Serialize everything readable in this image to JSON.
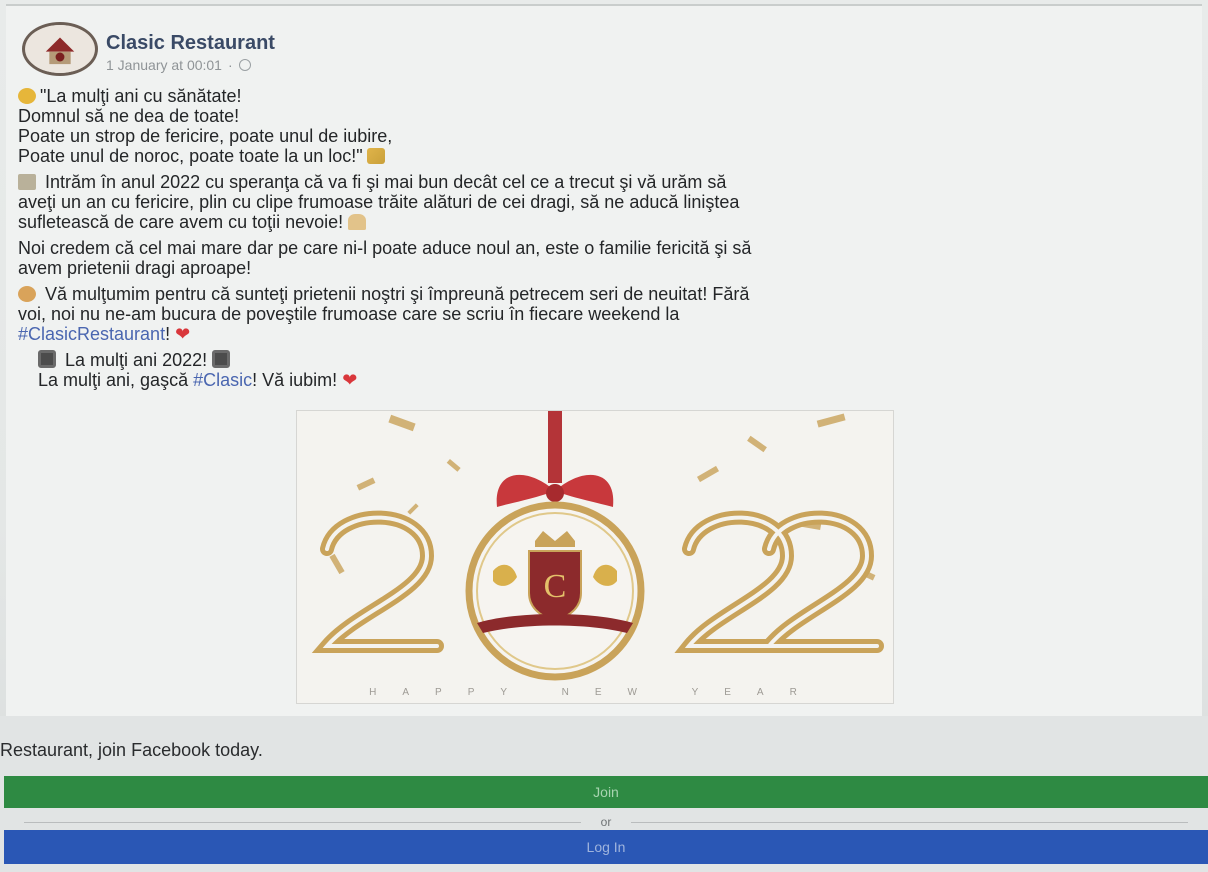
{
  "post": {
    "author": "Clasic Restaurant",
    "timestamp": "1 January at 00:01",
    "meta_separator": "·",
    "paragraphs": {
      "p1": {
        "l1": "\"La mulţi ani cu sănătate!",
        "l2": "Domnul să ne dea de toate!",
        "l3": "Poate un strop de fericire, poate unul de iubire,",
        "l4": "Poate unul de noroc, poate toate la un loc!\""
      },
      "p2": {
        "l1": "Intrăm în anul 2022 cu speranţa că va fi şi mai bun decât cel ce a trecut şi vă urăm să",
        "l2": "aveţi un an cu fericire, plin cu clipe frumoase trăite alături de cei dragi, să ne aducă liniştea",
        "l3": "sufletească de care avem cu toţii nevoie!"
      },
      "p3": {
        "l1": "Noi credem că cel mai mare dar pe care ni-l poate aduce noul an, este o familie fericită şi să",
        "l2": "avem prietenii dragi aproape!"
      },
      "p4": {
        "l1": "Vă mulţumim pentru că sunteţi prietenii noştri şi împreună petrecem seri de neuitat! Fără",
        "l2": "voi, noi nu ne-am bucura de poveştile frumoase care se scriu în fiecare weekend la",
        "l3_hashtag": "#ClasicRestaurant",
        "l3_end": "!"
      },
      "p5": {
        "l1": "La mulţi ani 2022!",
        "l2_start": "La mulţi ani, gaşcă ",
        "l2_hashtag": "#Clasic",
        "l2_end": "! Vă iubim!"
      }
    },
    "image": {
      "year_text": "2022",
      "subtitle": "HAPPY NEW YEAR",
      "logo_letter": "C"
    }
  },
  "join": {
    "prompt": "Restaurant, join Facebook today.",
    "join_label": "Join",
    "or_label": "or",
    "login_label": "Log In"
  },
  "colors": {
    "join_green": "#2e8a43",
    "login_blue": "#2a57b5",
    "hashtag": "#4a66b0",
    "heart": "#d9373b"
  },
  "icons": [
    "globe-icon",
    "heart-icon",
    "face-emoji-icon",
    "party-emoji-icon",
    "pray-emoji-icon"
  ]
}
